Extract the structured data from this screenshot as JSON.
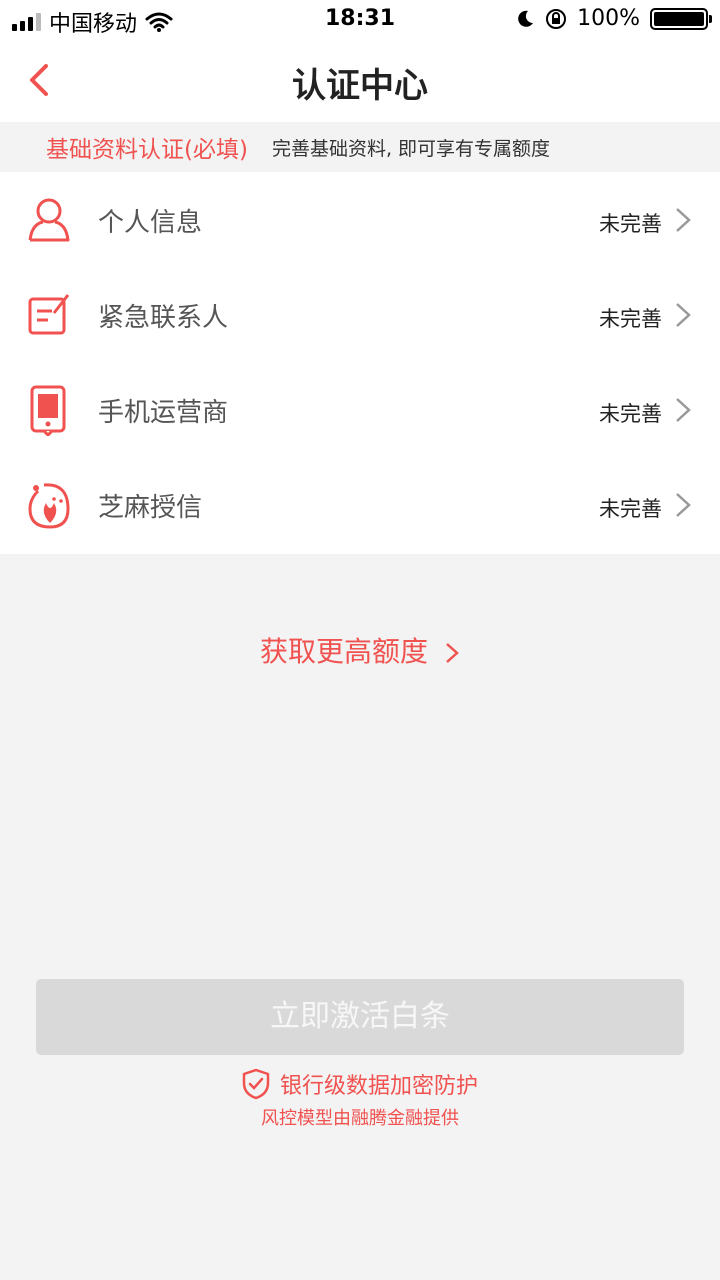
{
  "status_bar": {
    "carrier": "中国移动",
    "time": "18:31",
    "battery": "100%"
  },
  "nav": {
    "title": "认证中心"
  },
  "section": {
    "title": "基础资料认证(必填)",
    "subtitle": "完善基础资料, 即可享有专属额度"
  },
  "items": [
    {
      "label": "个人信息",
      "status": "未完善",
      "icon": "person-icon"
    },
    {
      "label": "紧急联系人",
      "status": "未完善",
      "icon": "contact-edit-icon"
    },
    {
      "label": "手机运营商",
      "status": "未完善",
      "icon": "phone-icon"
    },
    {
      "label": "芝麻授信",
      "status": "未完善",
      "icon": "sesame-credit-icon"
    }
  ],
  "more": {
    "label": "获取更高额度"
  },
  "activate": {
    "label": "立即激活白条"
  },
  "security": {
    "line1": "银行级数据加密防护",
    "line2": "风控模型由融腾金融提供"
  },
  "colors": {
    "accent": "#f05250",
    "disabled_button": "#d9d9d9",
    "background": "#f3f3f3"
  }
}
